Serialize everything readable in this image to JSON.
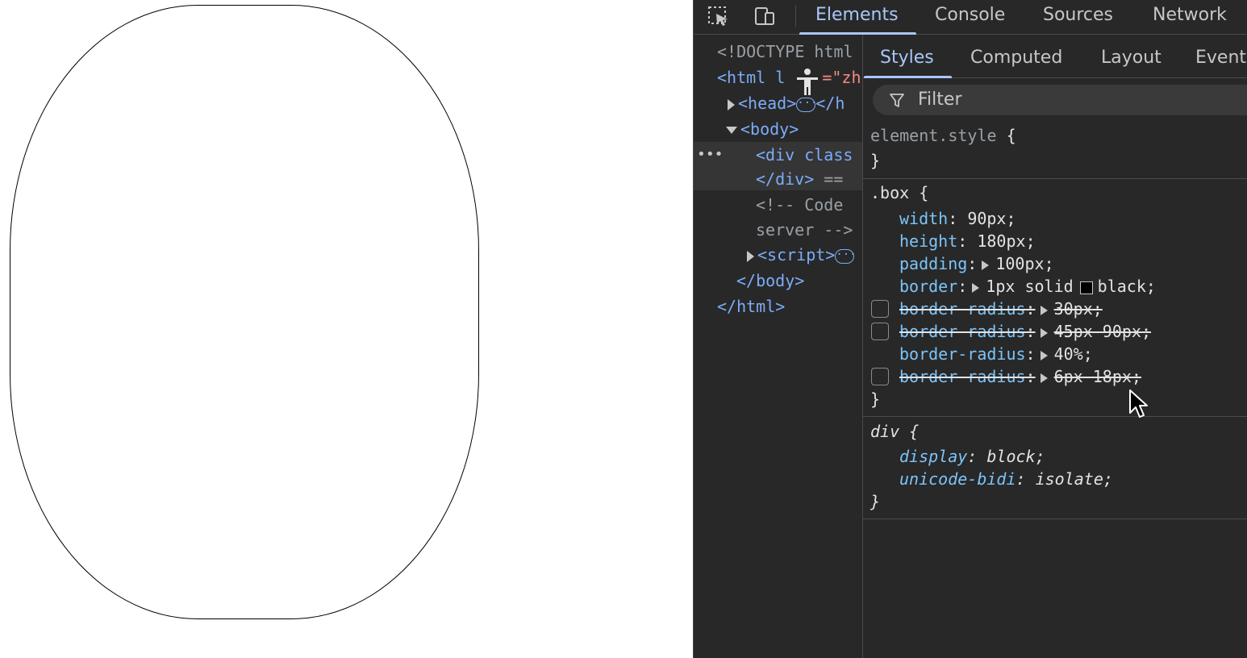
{
  "devtools": {
    "tabs": [
      "Elements",
      "Console",
      "Sources",
      "Network"
    ],
    "active_tab": "Elements",
    "icons": [
      "inspect-element-icon",
      "device-toolbar-icon"
    ]
  },
  "dom": {
    "doctype": "<!DOCTYPE html",
    "html_open": "<html l",
    "html_attr_value": "=\"zh",
    "head": "<head>",
    "head_close": "</h",
    "body_open": "<body>",
    "div_open": "<div class",
    "div_close": "</div>",
    "div_eq": "==",
    "comment_1": "<!-- Code",
    "comment_2": "server -->",
    "script": "<script>",
    "body_close": "</body>",
    "html_close": "</html>",
    "row_menu": "•••",
    "collapsed_marker": "···"
  },
  "styles": {
    "subtabs": [
      "Styles",
      "Computed",
      "Layout",
      "Event"
    ],
    "active_subtab": "Styles",
    "filter_placeholder": "Filter",
    "element_style": {
      "selector": "element.style",
      "open": "{",
      "close": "}"
    },
    "box_rule": {
      "selector": ".box",
      "open": "{",
      "close": "}",
      "declarations": [
        {
          "prop": "width",
          "value": "90px",
          "expandable": false,
          "disabled": false
        },
        {
          "prop": "height",
          "value": "180px",
          "expandable": false,
          "disabled": false
        },
        {
          "prop": "padding",
          "value": "100px",
          "expandable": true,
          "disabled": false
        },
        {
          "prop": "border",
          "value_pre": "1px solid",
          "value_post": "black",
          "swatch": "#000000",
          "expandable": true,
          "disabled": false
        },
        {
          "prop": "border-radius",
          "value": "30px",
          "expandable": true,
          "disabled": true
        },
        {
          "prop": "border-radius",
          "value": "45px 90px",
          "expandable": true,
          "disabled": true
        },
        {
          "prop": "border-radius",
          "value": "40%",
          "expandable": true,
          "disabled": false
        },
        {
          "prop": "border-radius",
          "value": "6px 18px",
          "expandable": true,
          "disabled": true
        }
      ]
    },
    "div_rule": {
      "selector": "div",
      "open": "{",
      "close": "}",
      "declarations": [
        {
          "prop": "display",
          "value": "block"
        },
        {
          "prop": "unicode-bidi",
          "value": "isolate"
        }
      ]
    }
  },
  "colors": {
    "devtools_bg": "#282828",
    "accent": "#a8c7fa",
    "tag": "#7cacf8",
    "property": "#7cc4fa",
    "attr_value": "#f28b82"
  }
}
